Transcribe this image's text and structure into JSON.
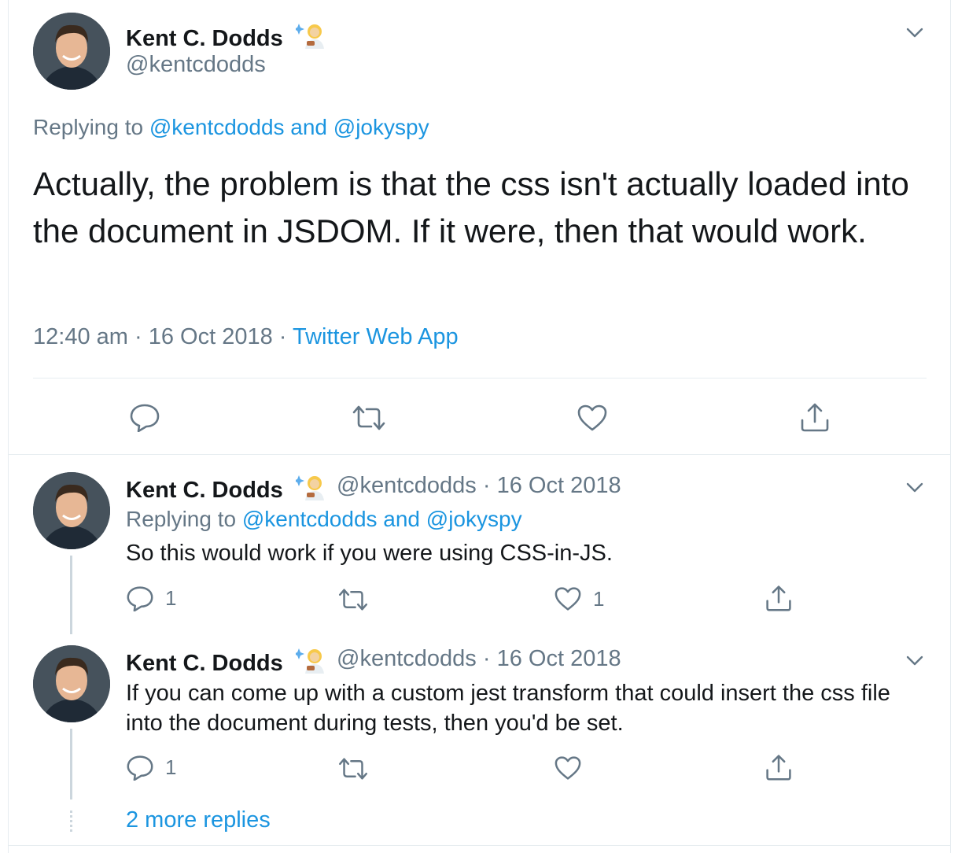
{
  "main_tweet": {
    "author_name": "Kent C. Dodds",
    "author_emoji": "scientist-emoji",
    "handle": "@kentcdodds",
    "replying_prefix": "Replying to ",
    "replying_targets": "@kentcdodds and @jokyspy",
    "text": "Actually, the problem is that the css isn't actually loaded into the document in JSDOM. If it were, then that would work.",
    "time": "12:40 am",
    "date": "16 Oct 2018",
    "separator": "·",
    "source": "Twitter Web App"
  },
  "replies": [
    {
      "author_name": "Kent C. Dodds",
      "handle": "@kentcdodds",
      "date": "16 Oct 2018",
      "separator": "·",
      "replying_prefix": "Replying to ",
      "replying_targets": "@kentcdodds and @jokyspy",
      "text": "So this would work if you were using CSS-in-JS.",
      "reply_count": "1",
      "like_count": "1"
    },
    {
      "author_name": "Kent C. Dodds",
      "handle": "@kentcdodds",
      "date": "16 Oct 2018",
      "separator": "·",
      "text": "If you can come up with a custom jest transform that could insert the css file into the document during tests, then you'd be set.",
      "reply_count": "1"
    }
  ],
  "more_replies": "2 more replies",
  "colors": {
    "link": "#1b95e0",
    "secondary_text": "#657786",
    "primary_text": "#14171a",
    "border": "#e6ecf0",
    "thread_line": "#ccd6dd"
  }
}
